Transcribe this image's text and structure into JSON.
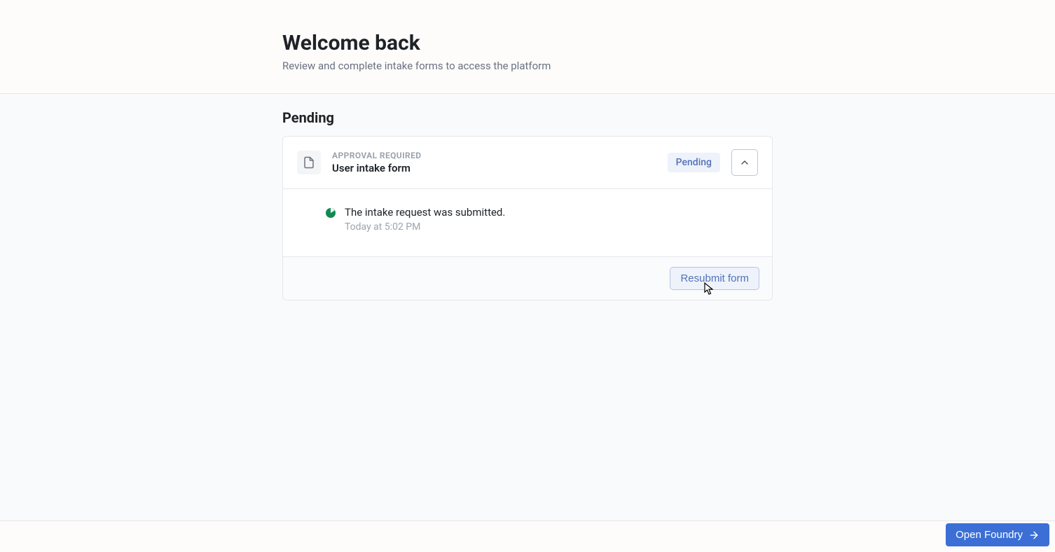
{
  "header": {
    "title": "Welcome back",
    "subtitle": "Review and complete intake forms to access the platform"
  },
  "section": {
    "title": "Pending"
  },
  "card": {
    "overline": "APPROVAL REQUIRED",
    "title": "User intake form",
    "status_badge": "Pending",
    "body": {
      "message": "The intake request was submitted.",
      "timestamp": "Today at 5:02 PM"
    },
    "footer": {
      "resubmit_label": "Resubmit form"
    }
  },
  "footer_button": {
    "label": "Open Foundry"
  }
}
